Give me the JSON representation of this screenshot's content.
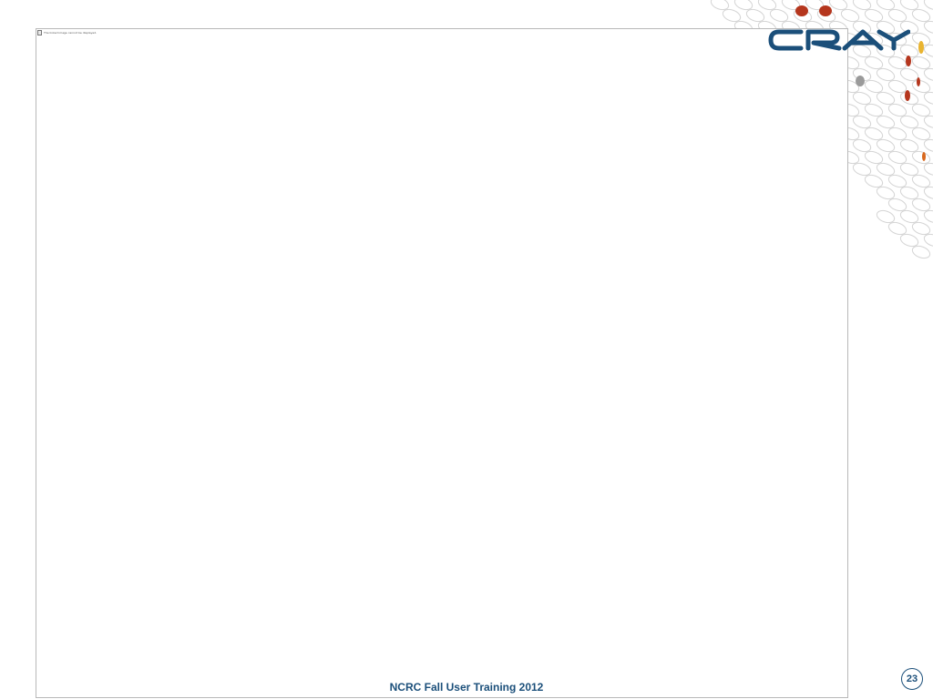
{
  "slide": {
    "footer_text": "NCRC Fall User Training 2012",
    "page_number": "23",
    "placeholder_image_caption": "The linked image cannot be displayed."
  },
  "logo": {
    "text": "CRAY",
    "icon": "cray-logo-icon"
  },
  "colors": {
    "brand_blue": "#1b4f7a",
    "accent_red": "#b5361d",
    "accent_orange": "#d8681e",
    "accent_yellow": "#e9b430",
    "accent_gray": "#9a9a9a",
    "frame_border": "#b8b8b8"
  }
}
